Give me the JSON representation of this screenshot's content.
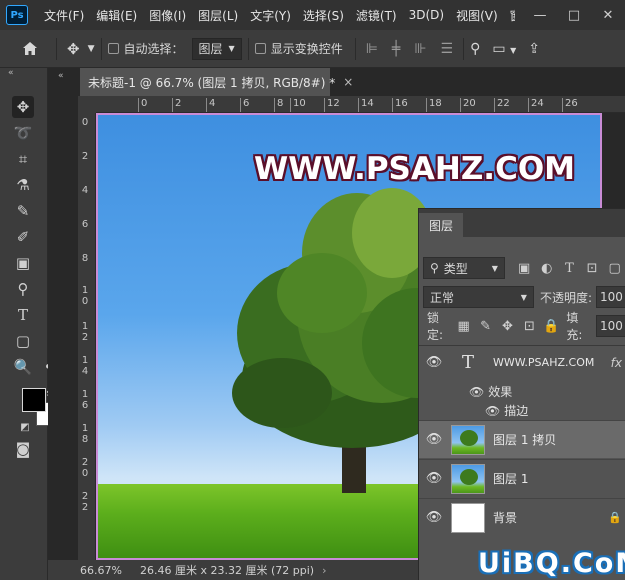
{
  "app": {
    "logo_text": "Ps"
  },
  "menu": {
    "items": [
      "文件(F)",
      "编辑(E)",
      "图像(I)",
      "图层(L)",
      "文字(Y)",
      "选择(S)",
      "滤镜(T)",
      "3D(D)",
      "视图(V)",
      "窗口(W"
    ]
  },
  "window_controls": {
    "minimize": "—",
    "restore": "□",
    "close": "✕"
  },
  "options_bar": {
    "auto_select_label": "自动选择：",
    "auto_select_value": "图层",
    "show_transform_label": "显示变换控件"
  },
  "document": {
    "tab_title": "未标题-1 @ 66.7% (图层 1 拷贝, RGB/8#) *",
    "close_glyph": "×",
    "ruler_h": [
      "0",
      "2",
      "4",
      "6",
      "8",
      "10",
      "12",
      "14",
      "16",
      "18",
      "20",
      "22",
      "24",
      "26"
    ],
    "ruler_v": [
      "0",
      "2",
      "4",
      "6",
      "8",
      "10",
      "12",
      "14",
      "16",
      "18",
      "20",
      "22"
    ],
    "watermark_text": "WWW.PSAHZ.COM"
  },
  "status": {
    "zoom": "66.67%",
    "info": "26.46 厘米 x 23.32 厘米 (72 ppi)",
    "arrow": "›"
  },
  "layers_panel": {
    "tab_label": "图层",
    "filter_kind": "类型",
    "blend_mode": "正常",
    "opacity_label": "不透明度:",
    "opacity_value": "100",
    "lock_label": "锁定:",
    "fill_label": "填充:",
    "fill_value": "100",
    "layers": [
      {
        "name": "WWW.PSAHZ.COM",
        "type": "text",
        "fx": "fx",
        "effects_label": "效果",
        "effect_stroke": "描边"
      },
      {
        "name": "图层 1 拷贝",
        "type": "image",
        "selected": true
      },
      {
        "name": "图层 1",
        "type": "image",
        "selected": false
      },
      {
        "name": "背景",
        "type": "background",
        "selected": false
      }
    ]
  },
  "site_watermark": "UiBQ.CoM",
  "colors": {
    "foreground": "#000000",
    "background": "#ffffff",
    "accent": "#31a8ff"
  }
}
